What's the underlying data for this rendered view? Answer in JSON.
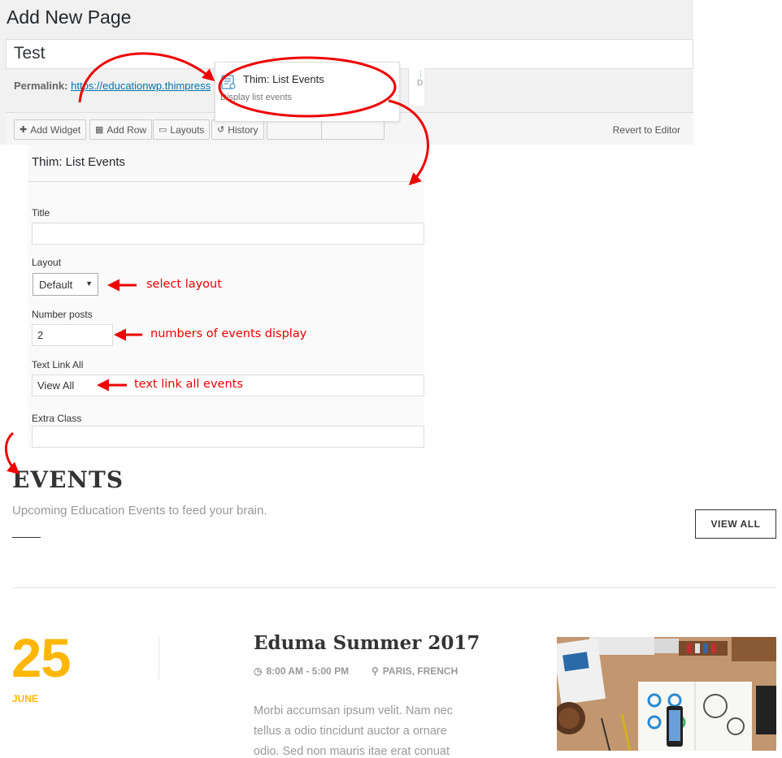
{
  "wp": {
    "page_title": "Add New Page",
    "post_title_value": "Test",
    "permalink_label": "Permalink:",
    "permalink_url": "https://educationwp.thimpress",
    "toolbar": {
      "add_widget": "Add Widget",
      "add_row": "Add Row",
      "layouts": "Layouts",
      "history": "History",
      "revert": "Revert to Editor"
    },
    "widget_card": {
      "title": "Thim: List Events",
      "description": "Display list events",
      "side_text": "D"
    }
  },
  "form": {
    "header": "Thim: List Events",
    "title_label": "Title",
    "title_value": "",
    "layout_label": "Layout",
    "layout_value": "Default",
    "number_posts_label": "Number posts",
    "number_posts_value": "2",
    "text_link_label": "Text Link All",
    "text_link_value": "View All",
    "extra_class_label": "Extra Class",
    "extra_class_value": ""
  },
  "annotations": {
    "select_layout": "select layout",
    "numbers_display": "numbers of events display",
    "text_link": "text link all events"
  },
  "preview": {
    "heading": "EVENTS",
    "subheading": "Upcoming Education Events to feed your brain.",
    "view_all": "VIEW ALL",
    "event": {
      "day": "25",
      "month": "JUNE",
      "name": "Eduma Summer 2017",
      "time": "8:00 AM - 5:00 PM",
      "location": "PARIS, FRENCH",
      "description": "Morbi accumsan ipsum velit. Nam nec tellus a odio tincidunt auctor a ornare odio. Sed non mauris itae erat conuat"
    }
  },
  "colors": {
    "accent_yellow": "#ffb606",
    "annotation_red": "#e00000",
    "link_blue": "#0073aa"
  }
}
